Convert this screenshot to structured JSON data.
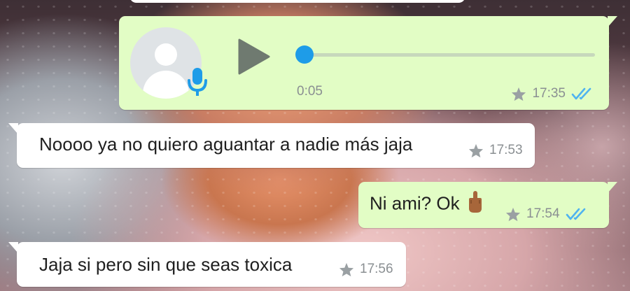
{
  "chat": {
    "messages": [
      {
        "id": "voice-note",
        "direction": "outgoing",
        "type": "voice",
        "duration": "0:05",
        "playback_progress": 0.0,
        "starred": true,
        "time": "17:35",
        "status": "read"
      },
      {
        "id": "msg-2",
        "direction": "incoming",
        "text": "Noooo ya no quiero aguantar a nadie más jaja",
        "starred": true,
        "time": "17:53"
      },
      {
        "id": "msg-3",
        "direction": "outgoing",
        "text": "Ni ami? Ok",
        "emoji": "middle-finger-emoji",
        "starred": true,
        "time": "17:54",
        "status": "read"
      },
      {
        "id": "msg-4",
        "direction": "incoming",
        "text": "Jaja si pero sin que seas toxica",
        "starred": true,
        "time": "17:56"
      }
    ]
  },
  "icons": {
    "star": "star-icon",
    "read_ticks": "double-check-icon",
    "play": "play-icon",
    "mic": "microphone-icon",
    "avatar": "default-avatar-icon"
  },
  "colors": {
    "outgoing_bubble": "#e2fdc5",
    "incoming_bubble": "#ffffff",
    "read_ticks": "#4fb3f0",
    "progress_thumb": "#1e9ce8",
    "mic": "#1e9ce8",
    "meta_text": "#8a8f92"
  }
}
